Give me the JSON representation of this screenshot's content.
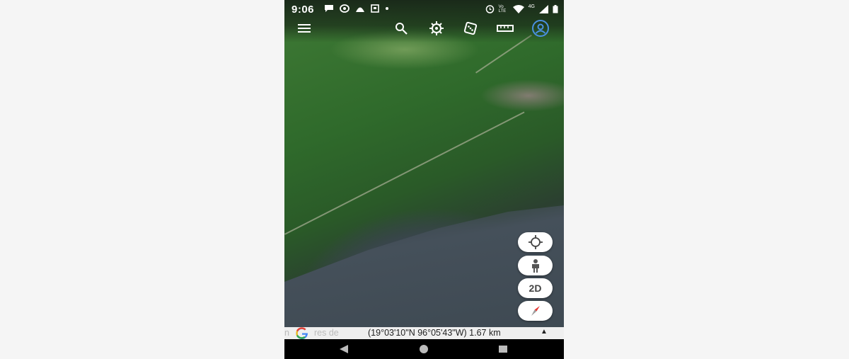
{
  "status_bar": {
    "time": "9:06",
    "left_icons": [
      "chat-icon",
      "chat-bubble-icon",
      "notification-icon",
      "screenshot-icon",
      "dot-icon"
    ],
    "right_icons": [
      "alarm-icon",
      "volte-icon",
      "wifi-icon",
      "cellular-4g-icon",
      "signal-icon",
      "battery-icon"
    ],
    "volte_label": "Vo LTE",
    "network_label": "4G"
  },
  "toolbar": {
    "items": [
      "menu-icon",
      "search-icon",
      "voyager-wheel-icon",
      "feeling-lucky-dice-icon",
      "measure-ruler-icon",
      "account-icon"
    ]
  },
  "map_controls": {
    "locate": "my-location-icon",
    "street_view": "pegman-icon",
    "view_mode_label": "2D",
    "compass": "compass-icon"
  },
  "attribution": {
    "faded_text": "n",
    "faded_text_2": "res de",
    "coordinates": "(19°03'10\"N 96°05'43\"W) 1.67 km",
    "expand_arrow": "▲"
  },
  "nav_bar": {
    "back": "back-icon",
    "home": "home-icon",
    "recents": "recents-icon"
  },
  "colors": {
    "account_icon": "#4a90e2",
    "map_forest": "#2f6a2b",
    "map_water": "#45505a"
  }
}
